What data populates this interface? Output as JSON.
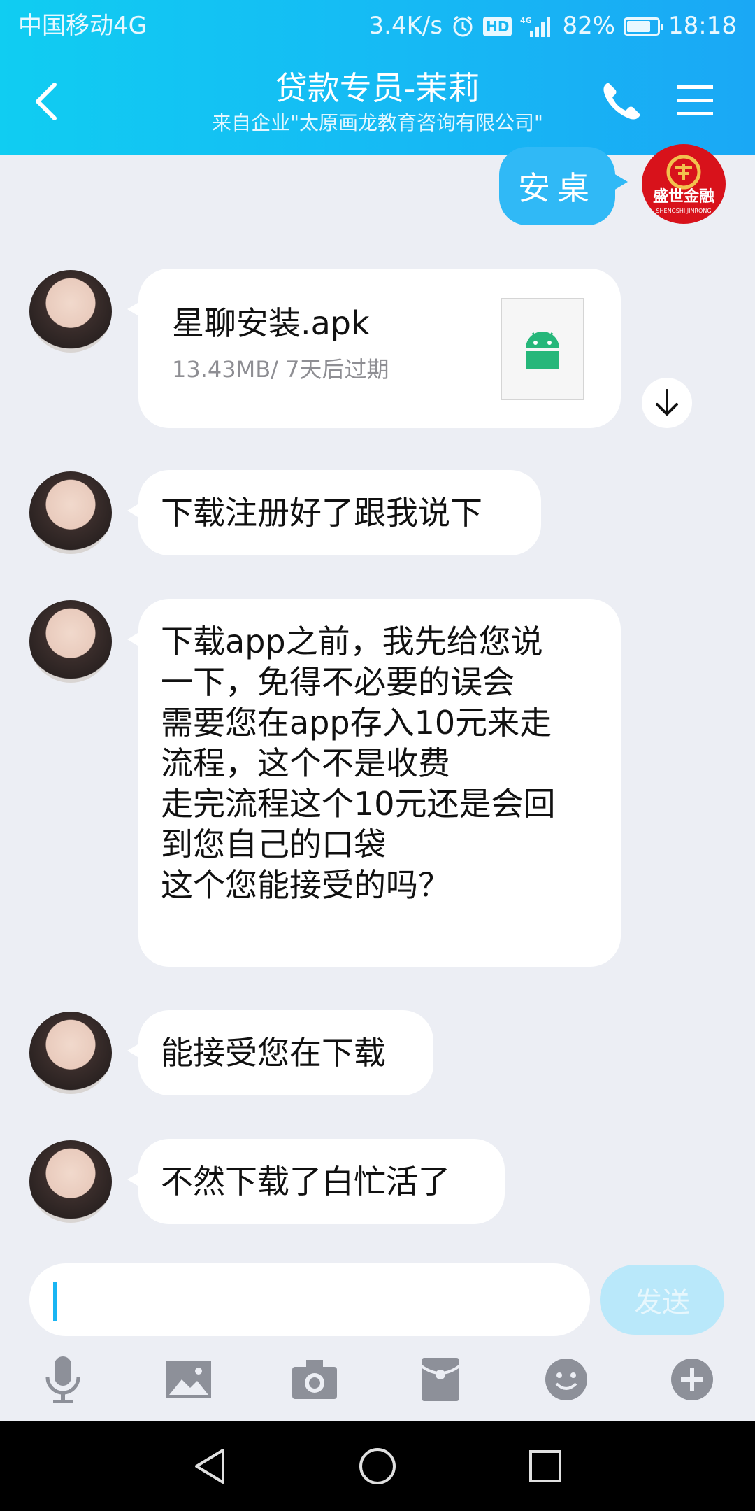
{
  "status_bar": {
    "carrier": "中国移动4G",
    "speed": "3.4K/s",
    "hd_label": "HD",
    "network": "4G",
    "battery": "82%",
    "battery_level": 0.82,
    "time": "18:18"
  },
  "header": {
    "title": "贷款专员-茉莉",
    "subtitle": "来自企业\"太原画龙教育咨询有限公司\""
  },
  "sent_message": {
    "text": "安桌",
    "avatar_logo_text": "盛世金融",
    "avatar_logo_sub": "SHENGSHI JINRONG"
  },
  "file_message": {
    "file_name": "星聊安装.apk",
    "meta": "13.43MB/ 7天后过期"
  },
  "messages": [
    {
      "lines": [
        "下载注册好了跟我说下"
      ]
    },
    {
      "lines": [
        "下载app之前，我先给您说",
        "一下，免得不必要的误会",
        "需要您在app存入10元来走",
        "流程，这个不是收费",
        "走完流程这个10元还是会回",
        "到您自己的口袋",
        "这个您能接受的吗？"
      ]
    },
    {
      "lines": [
        "能接受您在下载"
      ]
    },
    {
      "lines": [
        "不然下载了白忙活了"
      ]
    }
  ],
  "input": {
    "send_label": "发送"
  },
  "colors": {
    "header_start": "#10cdf2",
    "header_end": "#1aa8f5",
    "sent_bubble": "#30b9f6",
    "background": "#eceef4",
    "send_disabled": "#b9e8fa"
  },
  "icons": {
    "toolbar": [
      "microphone-icon",
      "image-icon",
      "camera-icon",
      "red-packet-icon",
      "emoji-icon",
      "plus-icon"
    ],
    "nav": [
      "back-triangle-icon",
      "home-circle-icon",
      "recents-square-icon"
    ]
  }
}
